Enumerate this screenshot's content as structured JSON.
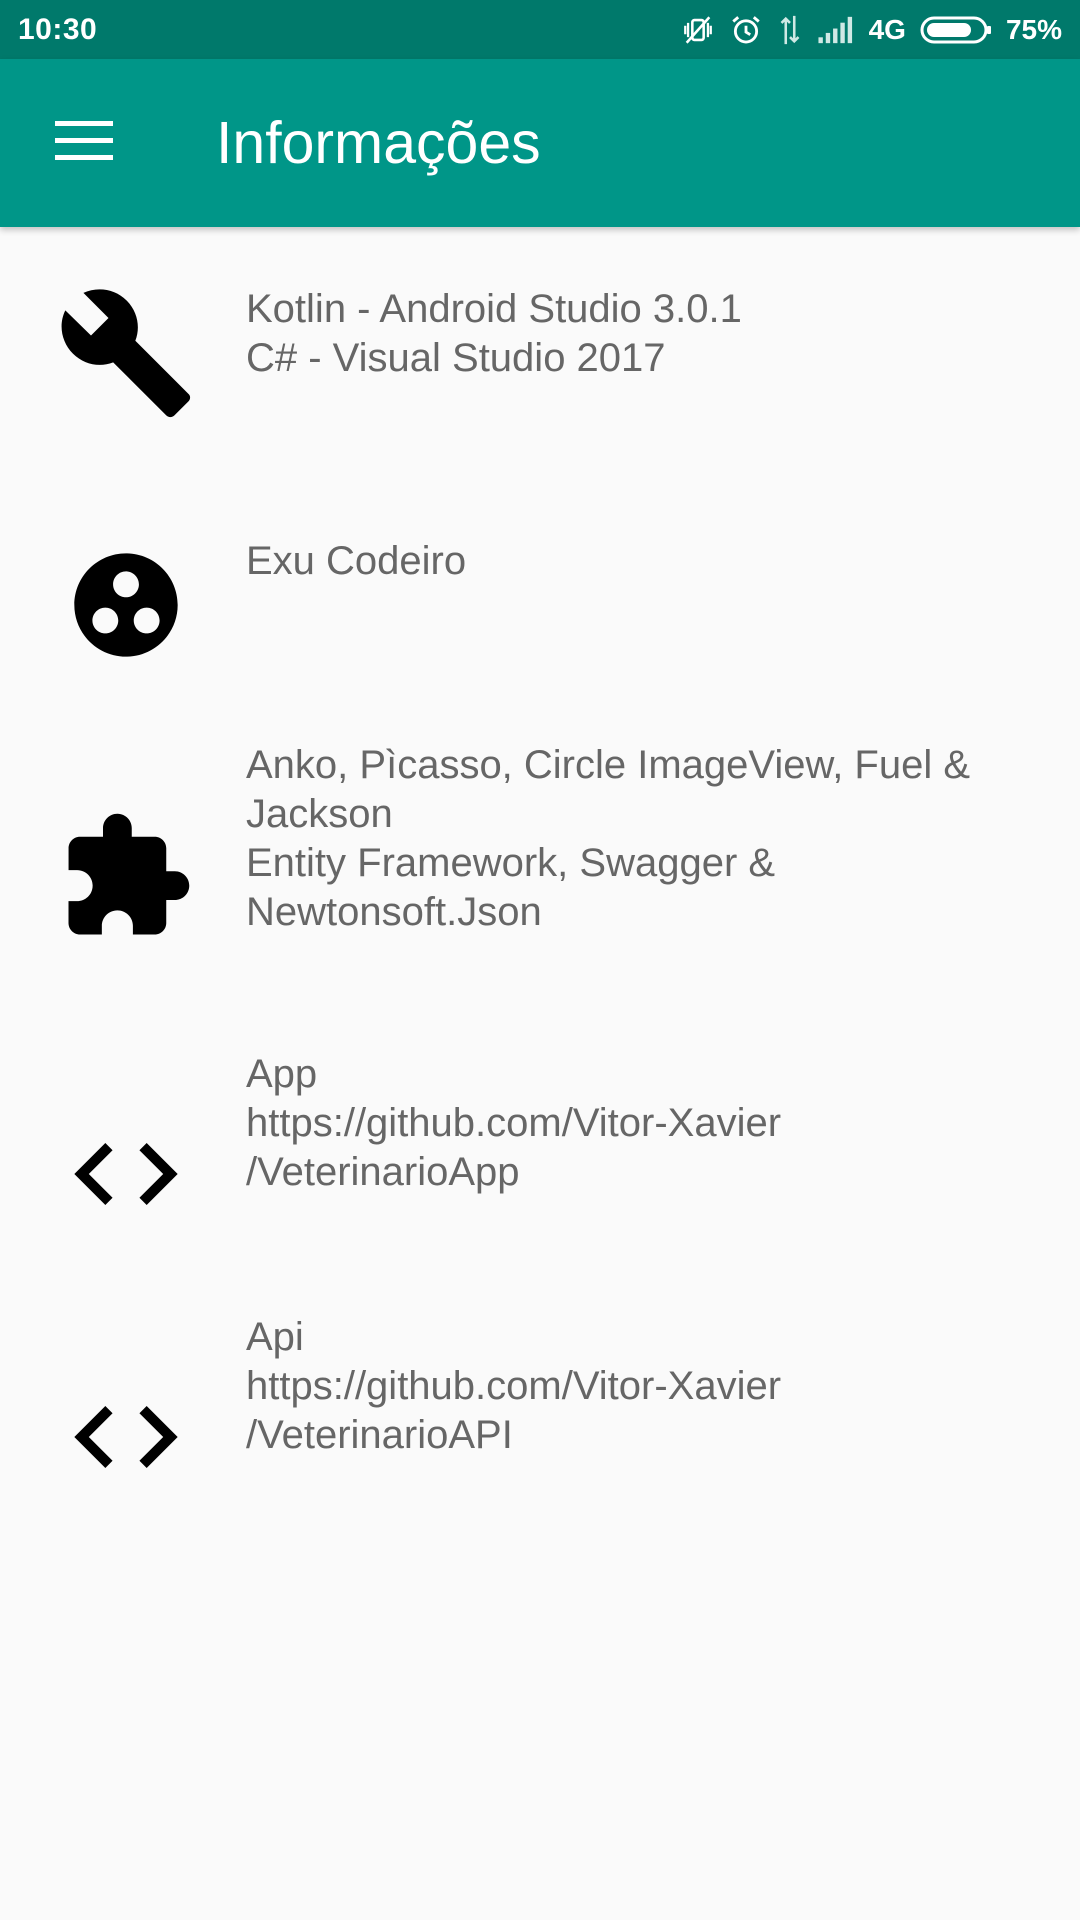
{
  "status_bar": {
    "time": "10:30",
    "network": "4G",
    "battery": "75%"
  },
  "app_bar": {
    "title": "Informações",
    "menu_icon": "hamburger-menu-icon"
  },
  "items": [
    {
      "icon": "wrench-icon",
      "lines": [
        "Kotlin - Android Studio 3.0.1",
        "C# - Visual Studio 2017"
      ]
    },
    {
      "icon": "group-work-icon",
      "lines": [
        "Exu Codeiro"
      ]
    },
    {
      "icon": "puzzle-extension-icon",
      "lines": [
        "Anko, Pìcasso, Circle ImageView, Fuel &",
        "Jackson",
        "Entity Framework, Swagger &",
        "Newtonsoft.Json"
      ]
    },
    {
      "icon": "code-icon",
      "lines": [
        "App",
        "https://github.com/Vitor-Xavier",
        "/VeterinarioApp"
      ]
    },
    {
      "icon": "code-icon",
      "lines": [
        "Api",
        "https://github.com/Vitor-Xavier",
        "/VeterinarioAPI"
      ]
    }
  ],
  "colors": {
    "status_bar": "#00796b",
    "app_bar": "#009688",
    "background": "#fafafa",
    "text": "#666666"
  }
}
